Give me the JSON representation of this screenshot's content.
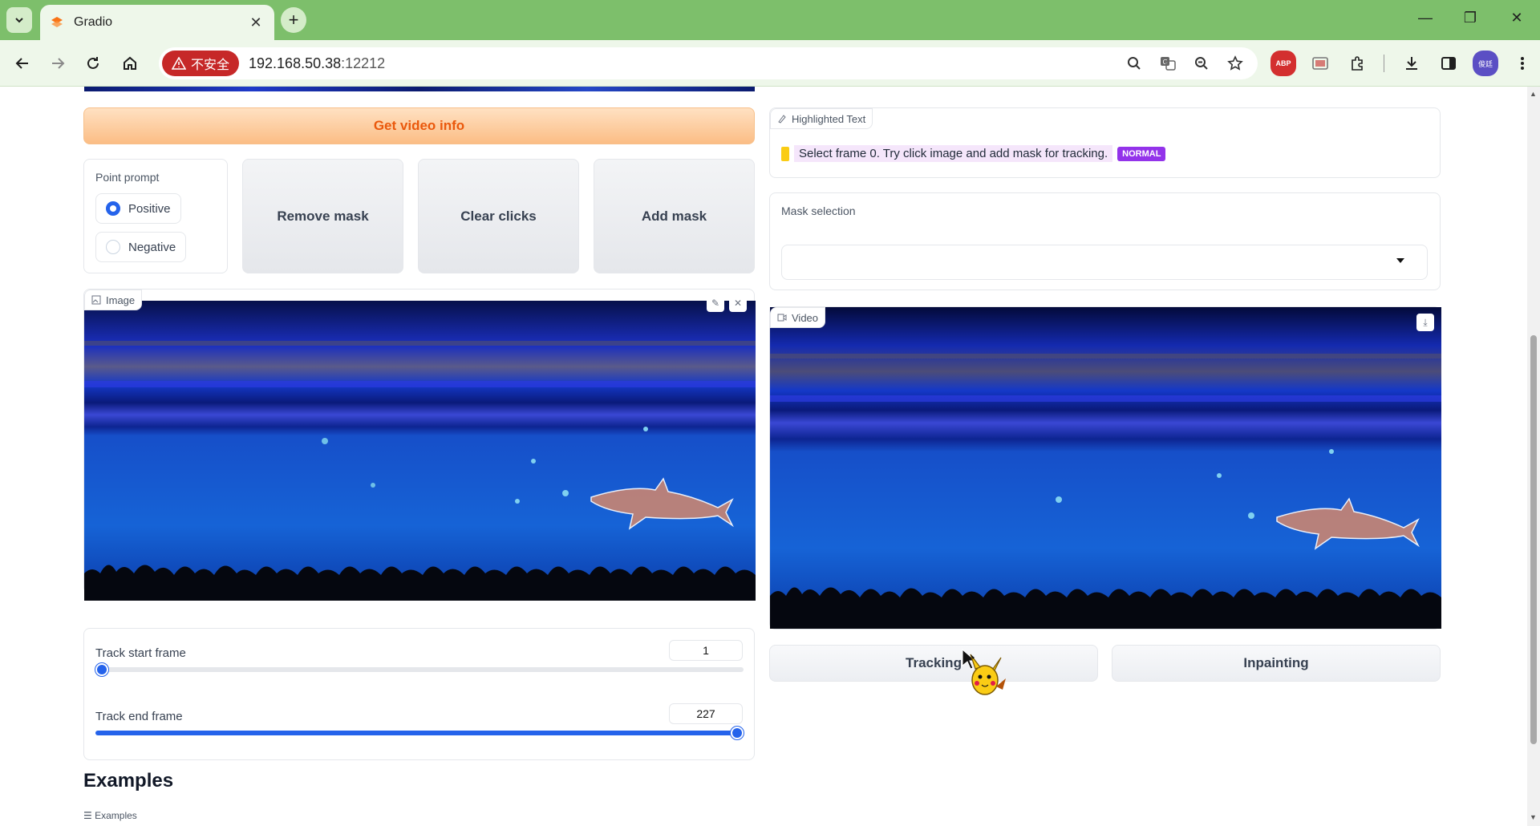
{
  "browser": {
    "tab_title": "Gradio",
    "tab_close": "✕",
    "new_tab": "+",
    "insecure_label": "不安全",
    "url_host": "192.168.50.38",
    "url_port": ":12212",
    "abp_label": "ABP",
    "profile_label": "俊廷",
    "window_controls": {
      "minimize": "—",
      "restore": "❐",
      "close": "✕"
    }
  },
  "left": {
    "get_video_info_button": "Get video info",
    "point_prompt": {
      "label": "Point prompt",
      "options": [
        "Positive",
        "Negative"
      ],
      "selected": "Positive"
    },
    "remove_mask_button": "Remove mask",
    "clear_clicks_button": "Clear clicks",
    "add_mask_button": "Add mask",
    "image_label": "Image",
    "track_start": {
      "label": "Track start frame",
      "value": "1",
      "fraction": 0.0
    },
    "track_end": {
      "label": "Track end frame",
      "value": "227",
      "fraction": 1.0
    }
  },
  "right": {
    "highlighted_text_label": "Highlighted Text",
    "highlight_message": "Select frame 0. Try click image and add mask for tracking.",
    "highlight_badge": "NORMAL",
    "mask_selection_label": "Mask selection",
    "mask_selection_value": "",
    "video_label": "Video",
    "tracking_button": "Tracking",
    "inpainting_button": "Inpainting"
  },
  "examples": {
    "heading": "Examples",
    "chip": "Examples"
  },
  "colors": {
    "accent_blue": "#2563eb",
    "orange_button_text": "#ea580c",
    "badge_purple": "#9333ea",
    "browser_theme": "#7dbf6b",
    "mask_color": "#c98572"
  }
}
